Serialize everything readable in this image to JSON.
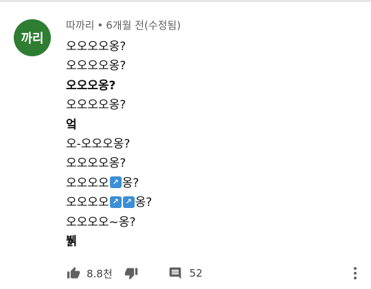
{
  "comment": {
    "avatar_text": "까리",
    "author": "따까리",
    "separator": "•",
    "time": "6개월 전(수정됨)",
    "lines": [
      {
        "text": "오오오오옹?",
        "bold": false
      },
      {
        "text": "오오오오옹?",
        "bold": false
      },
      {
        "text": "오오오옹?",
        "bold": true
      },
      {
        "text": "오오오오옹?",
        "bold": false
      },
      {
        "text": "엌",
        "bold": true
      },
      {
        "text": "오-오오오옹?",
        "bold": false
      },
      {
        "text": "오오오오옹?",
        "bold": false
      },
      {
        "prefix": "오오오오",
        "emoji_count": 1,
        "suffix": "옹?",
        "bold": false
      },
      {
        "prefix": "오오오오",
        "emoji_count": 2,
        "suffix": "옹?",
        "bold": false
      },
      {
        "text": "오오오오~옹?",
        "bold": false
      },
      {
        "text": "뷁",
        "bold": true
      }
    ]
  },
  "actions": {
    "like_count": "8.8천",
    "reply_count": "52"
  },
  "icons": {
    "like": "thumbs-up-icon",
    "dislike": "thumbs-down-icon",
    "reply": "comment-icon",
    "more": "more-vertical-icon",
    "emoji": "arrow-up-right-emoji"
  },
  "colors": {
    "avatar_bg": "#2e7d32",
    "emoji_bg": "#3b8fd6",
    "meta_text": "#606060"
  }
}
